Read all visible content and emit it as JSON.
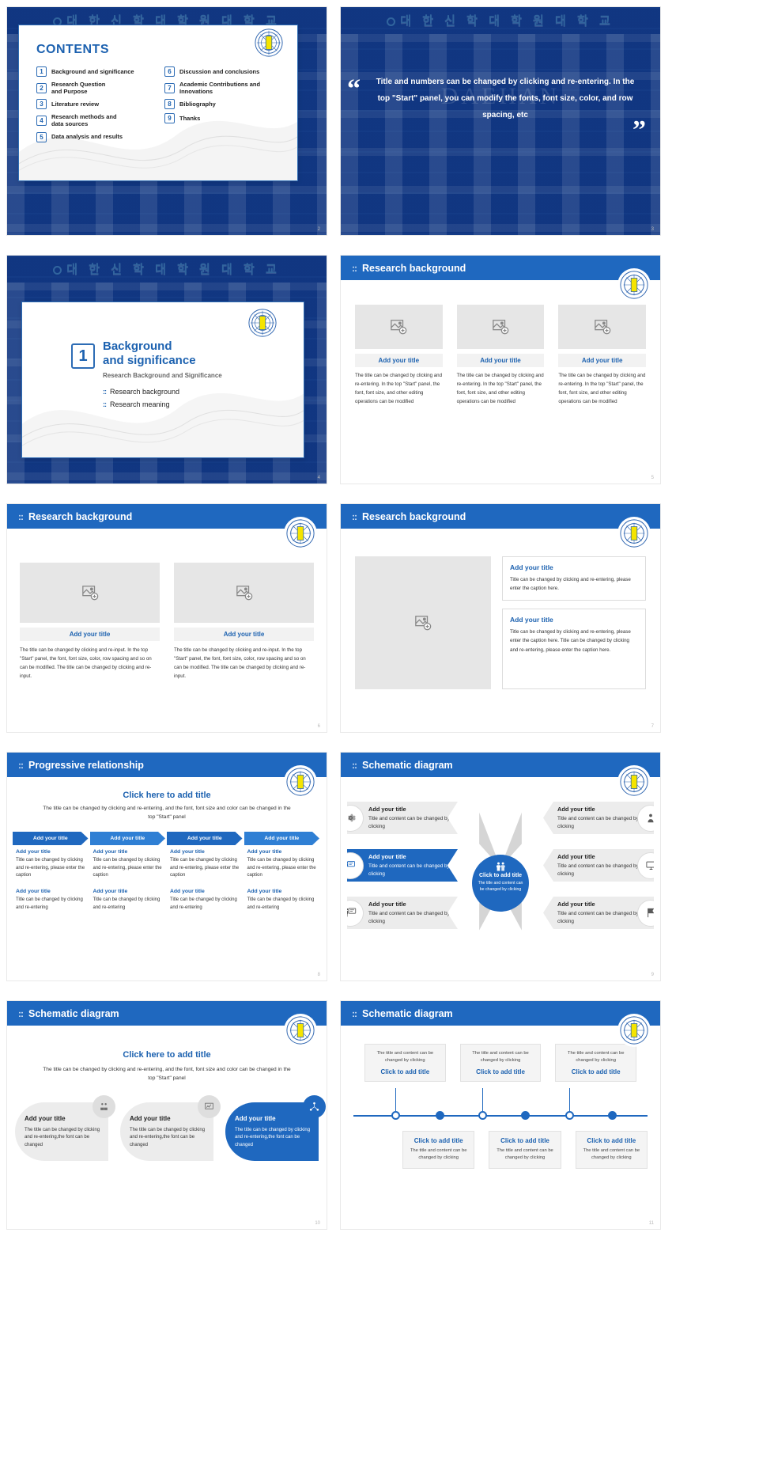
{
  "university": {
    "sign_text": "대 한 신 학 대 학 원 대 학 교",
    "ghost_text": "DAEHAN"
  },
  "slides": [
    {
      "page": "2",
      "title": "CONTENTS",
      "toc_left": [
        {
          "num": "1",
          "label": "Background and significance"
        },
        {
          "num": "2",
          "label": "Research Question\nand Purpose"
        },
        {
          "num": "3",
          "label": "Literature review"
        },
        {
          "num": "4",
          "label": "Research methods and\ndata sources"
        },
        {
          "num": "5",
          "label": "Data analysis and results"
        }
      ],
      "toc_right": [
        {
          "num": "6",
          "label": "Discussion and conclusions"
        },
        {
          "num": "7",
          "label": "Academic Contributions and\nInnovations"
        },
        {
          "num": "8",
          "label": "Bibliography"
        },
        {
          "num": "9",
          "label": "Thanks"
        }
      ]
    },
    {
      "page": "3",
      "quote": "Title and numbers can be changed by clicking and re-entering. In the top \"Start\" panel, you can modify the fonts, font size, color, and row spacing, etc"
    },
    {
      "page": "4",
      "number": "1",
      "heading": "Background\nand significance",
      "subheading": "Research Background and Significance",
      "bullets": [
        "Research background",
        "Research meaning"
      ]
    },
    {
      "page": "5",
      "topbar": "Research background",
      "cards": [
        {
          "caption": "Add your title",
          "body": "The title can be changed by clicking and re-entering. In the top \"Start\" panel, the font, font size, and other editing operations can be modified"
        },
        {
          "caption": "Add your title",
          "body": "The title can be changed by clicking and re-entering. In the top \"Start\" panel, the font, font size, and other editing operations can be modified"
        },
        {
          "caption": "Add your title",
          "body": "The title can be changed by clicking and re-entering. In the top \"Start\" panel, the font, font size, and other editing operations can be modified"
        }
      ]
    },
    {
      "page": "6",
      "topbar": "Research background",
      "cards": [
        {
          "caption": "Add your title",
          "body": "The title can be changed by clicking and re-input. In the top \"Start\" panel, the font, font size, color, row spacing and so on can be modified. The title can be changed by clicking and re-input."
        },
        {
          "caption": "Add your title",
          "body": "The title can be changed by clicking and re-input. In the top \"Start\" panel, the font, font size, color, row spacing and so on can be modified. The title can be changed by clicking and re-input."
        }
      ]
    },
    {
      "page": "7",
      "topbar": "Research background",
      "boxes": [
        {
          "title": "Add your title",
          "body": "Title can be changed by clicking and re-entering, please enter the caption here."
        },
        {
          "title": "Add your title",
          "body": "Title can be changed by clicking and re-entering, please enter the caption here. Title can be changed by clicking and re-entering, please enter the caption here."
        }
      ]
    },
    {
      "page": "8",
      "topbar": "Progressive relationship",
      "center_title": "Click here to add title",
      "center_sub": "The title can be changed by clicking and re-entering, and the font, font size and color can be changed in the top \"Start\" panel",
      "columns": [
        {
          "head": "Add your title",
          "row1_title": "Add your title",
          "row1_body": "Title can be changed by clicking and re-entering, please enter the caption",
          "row2_title": "Add your title",
          "row2_body": "Title can be changed by clicking and re-entering"
        },
        {
          "head": "Add your title",
          "row1_title": "Add your title",
          "row1_body": "Title can be changed by clicking and re-entering, please enter the caption",
          "row2_title": "Add your title",
          "row2_body": "Title can be changed by clicking and re-entering"
        },
        {
          "head": "Add your title",
          "row1_title": "Add your title",
          "row1_body": "Title can be changed by clicking and re-entering, please enter the caption",
          "row2_title": "Add your title",
          "row2_body": "Title can be changed by clicking and re-entering"
        },
        {
          "head": "Add your title",
          "row1_title": "Add your title",
          "row1_body": "Title can be changed by clicking and re-entering, please enter the caption",
          "row2_title": "Add your title",
          "row2_body": "Title can be changed by clicking and re-entering"
        }
      ]
    },
    {
      "page": "9",
      "topbar": "Schematic diagram",
      "hub_title": "Click to add title",
      "hub_body": "The title and content can be changed by clicking",
      "nodes_left": [
        {
          "title": "Add your title",
          "body": "Title and content can be changed by clicking",
          "icon": "gear-icon",
          "active": false
        },
        {
          "title": "Add your title",
          "body": "Title and content can be changed by clicking",
          "icon": "presenter-icon",
          "active": true
        },
        {
          "title": "Add your title",
          "body": "Title and content can be changed by clicking",
          "icon": "board-icon",
          "active": false
        }
      ],
      "nodes_right": [
        {
          "title": "Add your title",
          "body": "Title and content can be changed by clicking",
          "icon": "person-icon",
          "active": false
        },
        {
          "title": "Add your title",
          "body": "Title and content can be changed by clicking",
          "icon": "monitor-icon",
          "active": false
        },
        {
          "title": "Add your title",
          "body": "Title and content can be changed by clicking",
          "icon": "flag-icon",
          "active": false
        }
      ]
    },
    {
      "page": "10",
      "topbar": "Schematic diagram",
      "center_title": "Click here to add title",
      "center_sub": "The title can be changed by clicking and re-entering, and the font, font size and color can be changed in the top \"Start\" panel",
      "circles": [
        {
          "title": "Add your title",
          "body": "The title can be changed by clicking and re-entering,the font can be changed",
          "icon": "people-icon",
          "active": false
        },
        {
          "title": "Add your title",
          "body": "The title can be changed by clicking and re-entering,the font can be changed",
          "icon": "chart-icon",
          "active": false
        },
        {
          "title": "Add your title",
          "body": "The title can be changed by clicking and re-entering,the font can be changed",
          "icon": "network-icon",
          "active": true
        }
      ]
    },
    {
      "page": "11",
      "topbar": "Schematic diagram",
      "top_cards": [
        {
          "body": "The title and content can be changed by clicking",
          "title": "Click to add title"
        },
        {
          "body": "The title and content can be changed by clicking",
          "title": "Click to add title"
        },
        {
          "body": "The title and content can be changed by clicking",
          "title": "Click to add title"
        }
      ],
      "bottom_cards": [
        {
          "title": "Click to add title",
          "body": "The title and content can be changed by clicking"
        },
        {
          "title": "Click to add title",
          "body": "The title and content can be changed by clicking"
        },
        {
          "title": "Click to add title",
          "body": "The title and content can be changed by clicking"
        }
      ]
    }
  ],
  "colors": {
    "brand_blue": "#1f68bf",
    "dark_blue": "#1d62b0",
    "placeholder_gray": "#e6e6e6"
  }
}
